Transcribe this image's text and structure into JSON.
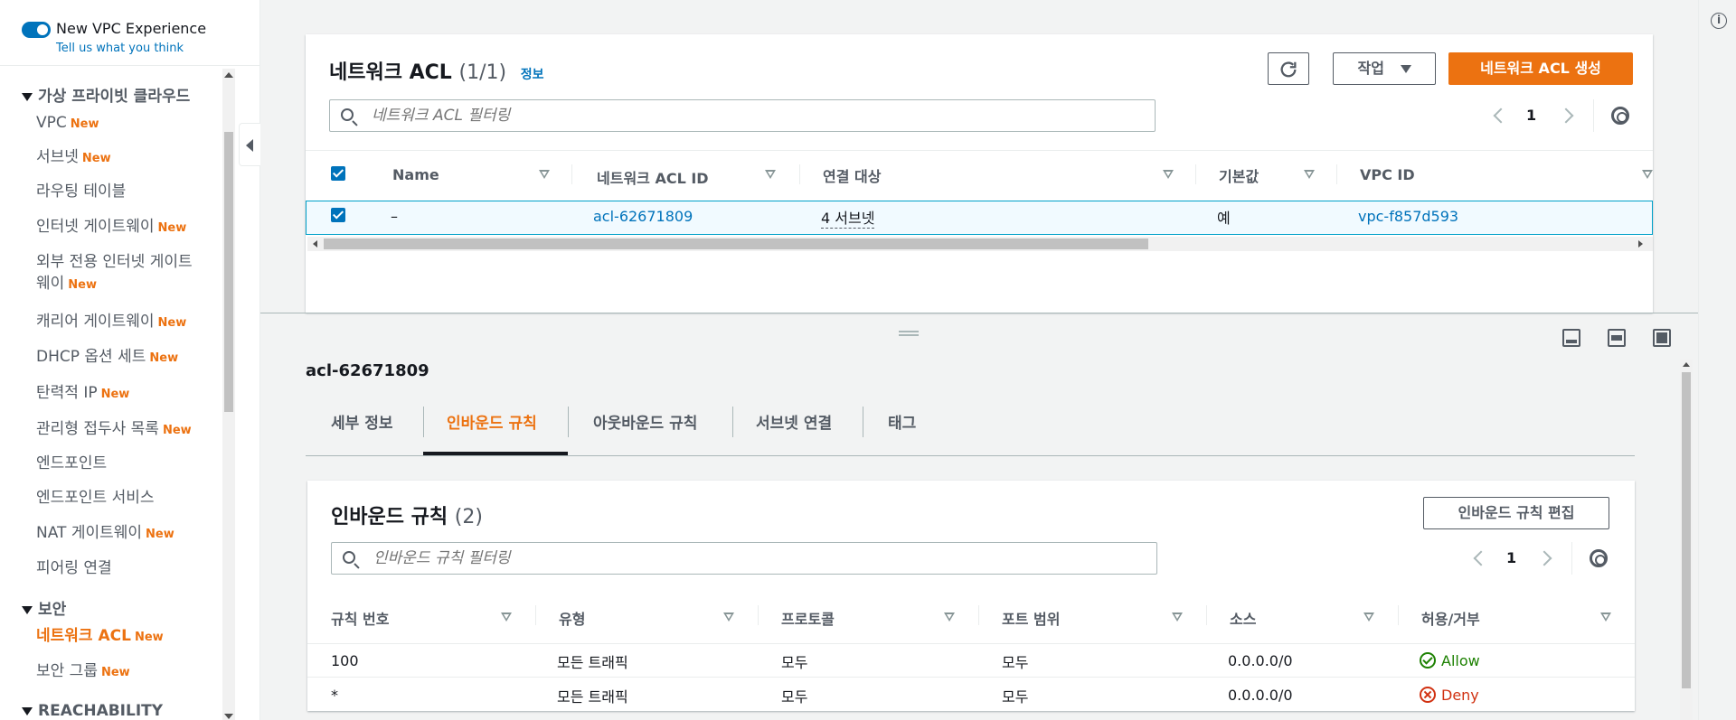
{
  "sidebar": {
    "toggle_label": "New VPC Experience",
    "feedback_link": "Tell us what you think",
    "new_badge": "New",
    "sections": [
      {
        "label": "가상 프라이빗 클라우드"
      },
      {
        "label": "보안"
      },
      {
        "label": "REACHABILITY"
      }
    ],
    "items": [
      {
        "label": "VPC",
        "badge": "New"
      },
      {
        "label": "서브넷",
        "badge": "New"
      },
      {
        "label": "라우팅 테이블",
        "badge": ""
      },
      {
        "label": "인터넷 게이트웨이",
        "badge": "New"
      },
      {
        "label": "외부 전용 인터넷 게이트",
        "label2": "웨이",
        "badge": "New"
      },
      {
        "label": "캐리어 게이트웨이",
        "badge": "New"
      },
      {
        "label": "DHCP 옵션 세트",
        "badge": "New"
      },
      {
        "label": "탄력적 IP",
        "badge": "New"
      },
      {
        "label": "관리형 접두사 목록",
        "badge": "New"
      },
      {
        "label": "엔드포인트",
        "badge": ""
      },
      {
        "label": "엔드포인트 서비스",
        "badge": ""
      },
      {
        "label": "NAT 게이트웨이",
        "badge": "New"
      },
      {
        "label": "피어링 연결",
        "badge": ""
      },
      {
        "label": "네트워크 ACL",
        "badge": "New"
      },
      {
        "label": "보안 그룹",
        "badge": "New"
      }
    ]
  },
  "acl_table": {
    "title": "네트워크 ACL",
    "count": "(1/1)",
    "info": "정보",
    "actions_label": "작업",
    "create_label": "네트워크 ACL 생성",
    "search_placeholder": "네트워크 ACL 필터링",
    "page": "1",
    "columns": [
      "Name",
      "네트워크 ACL ID",
      "연결 대상",
      "기본값",
      "VPC ID"
    ],
    "rows": [
      {
        "name": "–",
        "id": "acl-62671809",
        "assoc": "4 서브넷",
        "default": "예",
        "vpc": "vpc-f857d593"
      }
    ]
  },
  "detail": {
    "title": "acl-62671809",
    "tabs": [
      "세부 정보",
      "인바운드 규칙",
      "아웃바운드 규칙",
      "서브넷 연결",
      "태그"
    ],
    "active_tab": "인바운드 규칙"
  },
  "inbound": {
    "title": "인바운드 규칙",
    "count": "(2)",
    "edit_label": "인바운드 규칙 편집",
    "search_placeholder": "인바운드 규칙 필터링",
    "page": "1",
    "columns": [
      "규칙 번호",
      "유형",
      "프로토콜",
      "포트 범위",
      "소스",
      "허용/거부"
    ],
    "rows": [
      {
        "rule": "100",
        "type": "모든 트래픽",
        "protocol": "모두",
        "port": "모두",
        "source": "0.0.0.0/0",
        "action": "Allow",
        "status": "allow"
      },
      {
        "rule": "*",
        "type": "모든 트래픽",
        "protocol": "모두",
        "port": "모두",
        "source": "0.0.0.0/0",
        "action": "Deny",
        "status": "deny"
      }
    ]
  },
  "colors": {
    "accent": "#ec7211",
    "link": "#0073bb",
    "allow": "#1d8102",
    "deny": "#d13212"
  },
  "icons": [
    "refresh-icon",
    "caret-down-icon",
    "search-icon",
    "chevron-left-icon",
    "chevron-right-icon",
    "gear-icon",
    "info-icon",
    "check-circle-icon",
    "x-circle-icon"
  ]
}
